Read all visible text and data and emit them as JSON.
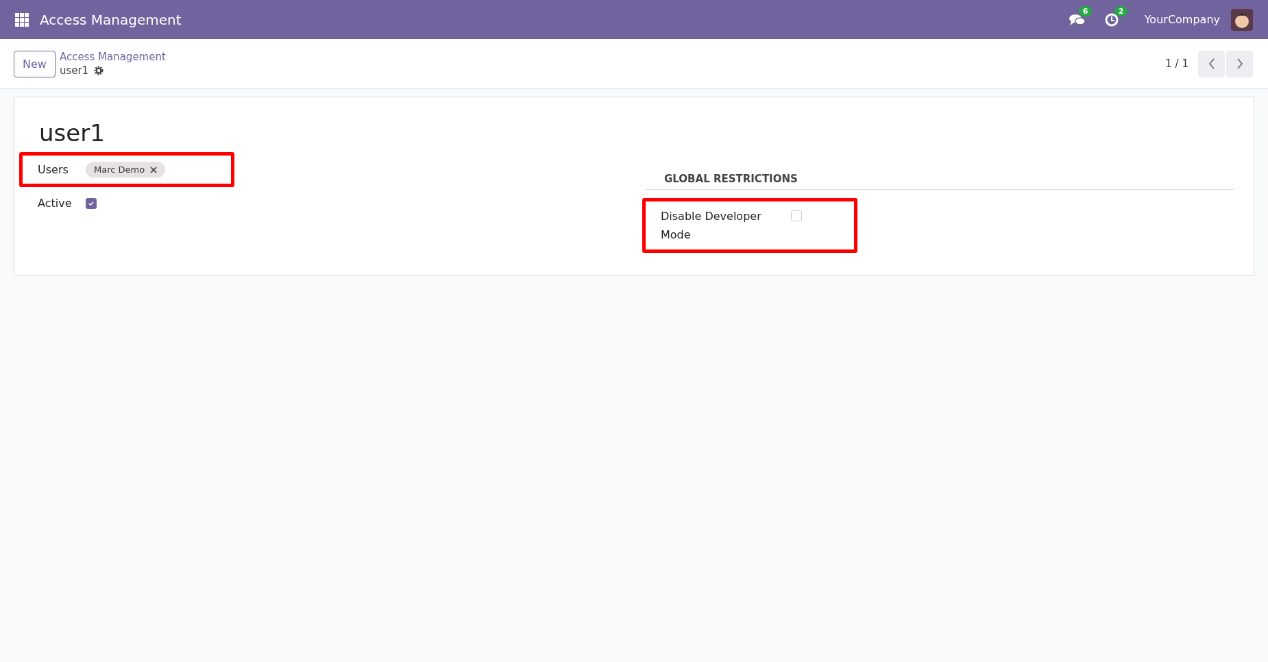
{
  "navbar": {
    "app_title": "Access Management",
    "messages_count": "6",
    "activities_count": "2",
    "company": "YourCompany"
  },
  "control_panel": {
    "new_button": "New",
    "breadcrumb": "Access Management",
    "record": "user1",
    "pager": "1 / 1"
  },
  "form": {
    "title": "user1",
    "users": {
      "label": "Users",
      "tags": [
        "Marc Demo"
      ],
      "highlighted": true
    },
    "active": {
      "label": "Active",
      "checked": true
    },
    "section_title": "GLOBAL RESTRICTIONS",
    "disable_developer_mode": {
      "label": "Disable Developer Mode",
      "checked": false,
      "highlighted": true
    }
  }
}
